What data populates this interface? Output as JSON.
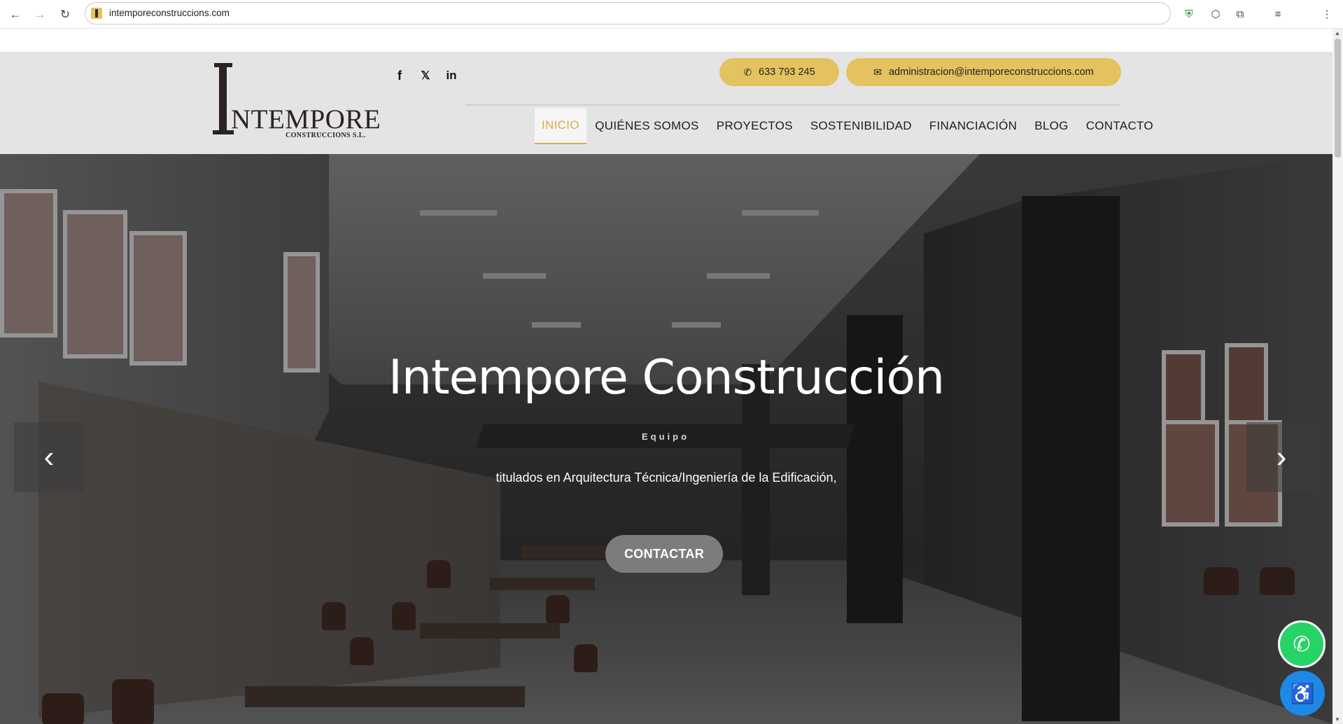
{
  "browser": {
    "url": "intemporeconstruccions.com",
    "back_icon": "←",
    "forward_icon": "→",
    "reload_icon": "↻",
    "ext1": "⛨",
    "ext2": "⬡",
    "ext3": "⧉",
    "ext4": "≡",
    "menu_icon": "⋮"
  },
  "header": {
    "logo_letter": "I",
    "logo_word": "NTEMPORE",
    "logo_sub": "CONSTRUCCIONS S.L.",
    "social": {
      "facebook": "f",
      "x": "𝕏",
      "linkedin": "in"
    },
    "phone_icon": "✆",
    "phone": "633 793 245",
    "email_icon": "✉",
    "email": "administracion@intemporeconstruccions.com",
    "menu": [
      {
        "label": "INICIO",
        "active": true
      },
      {
        "label": "QUIÉNES SOMOS"
      },
      {
        "label": "PROYECTOS"
      },
      {
        "label": "SOSTENIBILIDAD"
      },
      {
        "label": "FINANCIACIÓN"
      },
      {
        "label": "BLOG"
      },
      {
        "label": "CONTACTO"
      }
    ]
  },
  "hero": {
    "title": "Intempore Construcción",
    "ribbon": "Equipo",
    "description": "titulados en Arquitectura Técnica/Ingeniería de la Edificación,",
    "cta": "CONTACTAR",
    "prev_icon": "‹",
    "next_icon": "›"
  },
  "floating": {
    "whatsapp_icon": "✆",
    "accessibility_icon": "♿"
  },
  "colors": {
    "accent": "#e3c25f",
    "active_menu": "#d8ae4b",
    "whatsapp": "#25d366",
    "accessibility": "#1e88e5"
  }
}
